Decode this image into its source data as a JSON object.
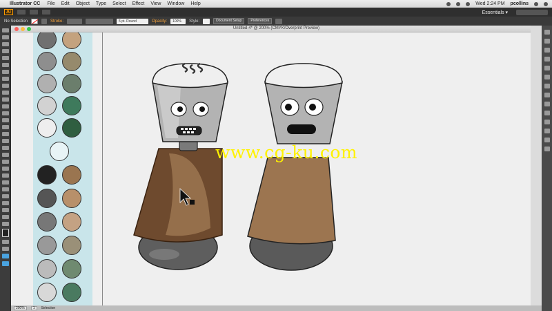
{
  "menubar": {
    "apple_glyph": "",
    "app_name": "Illustrator CC",
    "items": [
      "File",
      "Edit",
      "Object",
      "Type",
      "Select",
      "Effect",
      "View",
      "Window",
      "Help"
    ],
    "clock": "Wed 2:24 PM",
    "user": "pcollins"
  },
  "appbar": {
    "logo": "Ai",
    "workspace": "Essentials ▾"
  },
  "controlbar": {
    "selection": "No Selection",
    "stroke_label": "Stroke:",
    "brush": "5 pt. Round",
    "opacity_label": "Opacity:",
    "opacity_value": "100%",
    "style_label": "Style:",
    "document_setup": "Document Setup",
    "preferences": "Preferences"
  },
  "document": {
    "title": "Untitled-4* @ 200% (CMYK/Overprint Preview)"
  },
  "statusbar": {
    "zoom": "200%",
    "page": "1",
    "tool": "Selection"
  },
  "watermark": "www.cg-ku.com",
  "colors": {
    "swatch_panel_bg": "#c9e5ea",
    "body_brown": "#9c7550",
    "body_brown_shaded": "#6e4a2e",
    "head_gray": "#b3b3b3",
    "base_gray": "#5a5a5a",
    "watermark": "#fff200"
  }
}
